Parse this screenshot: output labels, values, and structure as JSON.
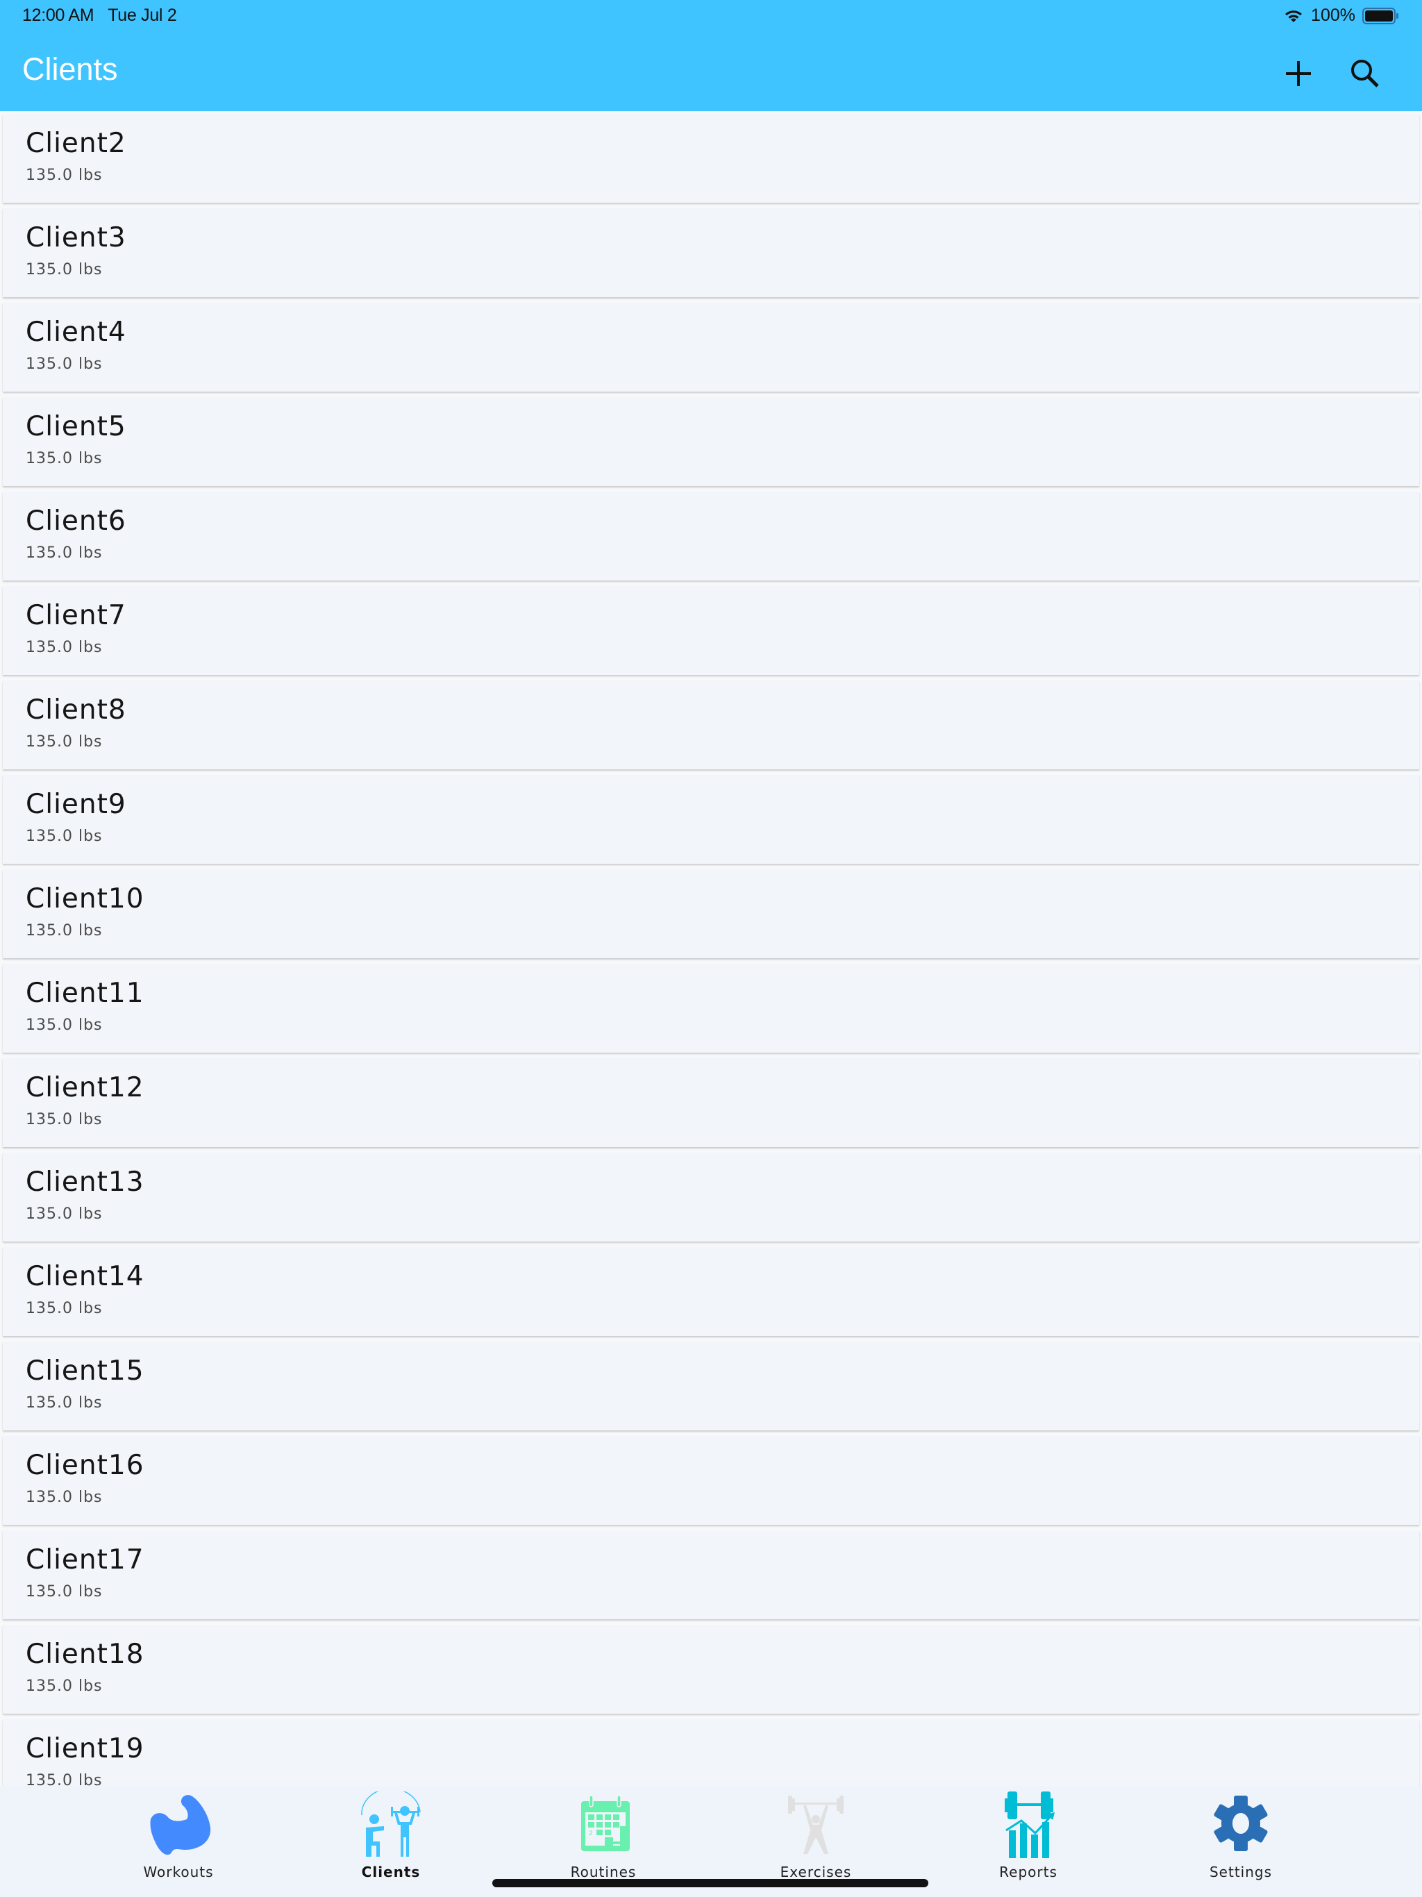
{
  "status_bar": {
    "time": "12:00 AM",
    "date": "Tue Jul 2",
    "battery_percent": "100%",
    "wifi_icon": "wifi-icon",
    "battery_icon": "battery-full-icon"
  },
  "header": {
    "title": "Clients",
    "add_icon": "plus-icon",
    "search_icon": "search-icon",
    "background_color": "#40c4ff"
  },
  "clients": [
    {
      "name": "Client2",
      "weight": "135.0 lbs"
    },
    {
      "name": "Client3",
      "weight": "135.0 lbs"
    },
    {
      "name": "Client4",
      "weight": "135.0 lbs"
    },
    {
      "name": "Client5",
      "weight": "135.0 lbs"
    },
    {
      "name": "Client6",
      "weight": "135.0 lbs"
    },
    {
      "name": "Client7",
      "weight": "135.0 lbs"
    },
    {
      "name": "Client8",
      "weight": "135.0 lbs"
    },
    {
      "name": "Client9",
      "weight": "135.0 lbs"
    },
    {
      "name": "Client10",
      "weight": "135.0 lbs"
    },
    {
      "name": "Client11",
      "weight": "135.0 lbs"
    },
    {
      "name": "Client12",
      "weight": "135.0 lbs"
    },
    {
      "name": "Client13",
      "weight": "135.0 lbs"
    },
    {
      "name": "Client14",
      "weight": "135.0 lbs"
    },
    {
      "name": "Client15",
      "weight": "135.0 lbs"
    },
    {
      "name": "Client16",
      "weight": "135.0 lbs"
    },
    {
      "name": "Client17",
      "weight": "135.0 lbs"
    },
    {
      "name": "Client18",
      "weight": "135.0 lbs"
    },
    {
      "name": "Client19",
      "weight": "135.0 lbs"
    }
  ],
  "tabbar": {
    "active": "Clients",
    "tabs": [
      {
        "label": "Workouts",
        "icon": "flexed-bicep-icon",
        "color": "#448aff"
      },
      {
        "label": "Clients",
        "icon": "trainer-client-icon",
        "color": "#40c4ff"
      },
      {
        "label": "Routines",
        "icon": "calendar-dumbbell-icon",
        "color": "#69f0ae"
      },
      {
        "label": "Exercises",
        "icon": "weightlifter-icon",
        "color": "#e0e0e0"
      },
      {
        "label": "Reports",
        "icon": "barbell-chart-icon",
        "color": "#00bcd4"
      },
      {
        "label": "Settings",
        "icon": "gear-icon",
        "color": "#2a6fb5"
      }
    ]
  }
}
